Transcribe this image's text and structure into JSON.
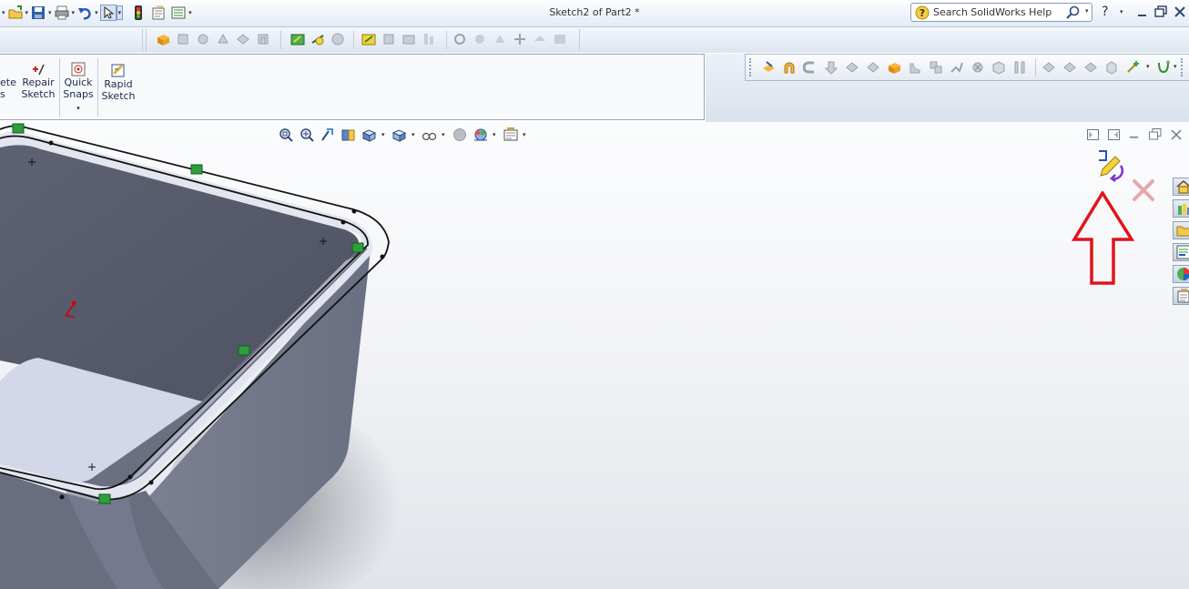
{
  "window": {
    "title": "Sketch2 of Part2 *"
  },
  "quick_access": {
    "icons": [
      "new-doc-icon",
      "open-folder-icon",
      "save-icon",
      "print-icon",
      "undo-icon",
      "select-arrow-icon",
      "rebuild-traffic-light-icon",
      "file-properties-icon",
      "options-icon"
    ]
  },
  "help": {
    "search_placeholder": "Search SolidWorks Help",
    "help_symbol": "?"
  },
  "sketch_tools": {
    "partial_label_line1": "ete",
    "partial_label_line2": "s",
    "repair_sketch_line1": "Repair",
    "repair_sketch_line2": "Sketch",
    "quick_snaps_line1": "Quick",
    "quick_snaps_line2": "Snaps",
    "rapid_sketch_line1": "Rapid",
    "rapid_sketch_line2": "Sketch"
  },
  "confirmation_corner": {
    "exit_sketch_icon": "exit-sketch-icon",
    "cancel_icon": "cancel-x-icon"
  },
  "annotation": {
    "arrow_color": "#e0131b"
  },
  "task_pane": {
    "icons": [
      "home-icon",
      "design-library-icon",
      "file-explorer-icon",
      "view-palette-icon",
      "appearances-icon",
      "custom-properties-icon"
    ]
  },
  "colors": {
    "model_face": "#6e7386",
    "model_inner": "#575b6c",
    "model_floor": "#d4d8ea",
    "model_rim": "#dfe3ef",
    "sketch_relation": "#2e9e3e"
  }
}
